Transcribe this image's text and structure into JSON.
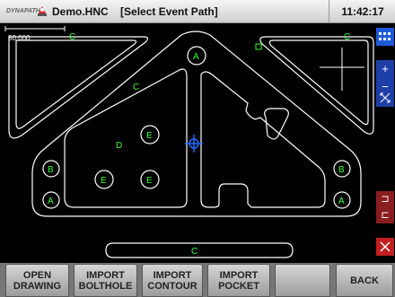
{
  "titlebar": {
    "logo": "DYNAPATH",
    "document": "Demo.HNC",
    "mode": "[Select Event Path]",
    "clock": "11:42:17"
  },
  "canvas": {
    "scale_label": "50.000",
    "feature_labels": {
      "c_top_left": "C",
      "c_top_right": "C",
      "c_center": "C",
      "c_bottom": "C",
      "a_top": "A",
      "a_left": "A",
      "a_right": "A",
      "b_left": "B",
      "b_right": "B",
      "d": "D",
      "e_top": "E",
      "e_mid_left": "E",
      "e_mid_right": "E"
    },
    "colors": {
      "geometry": "#ffffff",
      "labels": "#33ff33",
      "marker": "#1e6bff"
    }
  },
  "right_toolbar": {
    "icons": [
      "grid-menu-icon",
      "zoom-in-icon",
      "zoom-out-icon",
      "fit-view-icon",
      "undo-icon",
      "redo-icon",
      "delete-icon"
    ]
  },
  "footer": {
    "buttons": [
      {
        "line1": "OPEN",
        "line2": "DRAWING"
      },
      {
        "line1": "IMPORT",
        "line2": "BOLTHOLE"
      },
      {
        "line1": "IMPORT",
        "line2": "CONTOUR"
      },
      {
        "line1": "IMPORT",
        "line2": "POCKET"
      },
      {
        "line1": "",
        "line2": ""
      },
      {
        "line1": "BACK",
        "line2": ""
      }
    ]
  }
}
